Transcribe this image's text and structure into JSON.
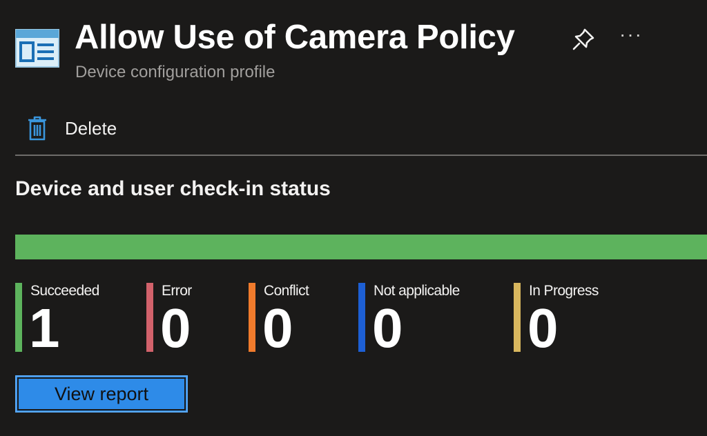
{
  "header": {
    "title": "Allow Use of Camera Policy",
    "subtitle": "Device configuration profile",
    "pin_icon": "pin-icon",
    "more_label": "···"
  },
  "command_bar": {
    "delete_label": "Delete",
    "delete_icon": "trash-icon"
  },
  "status_section": {
    "title": "Device and user check-in status",
    "progress": {
      "succeeded_fraction": 1.0,
      "fill_color": "#5db35d"
    },
    "items": [
      {
        "label": "Succeeded",
        "count": "1",
        "color": "#5db35d"
      },
      {
        "label": "Error",
        "count": "0",
        "color": "#d2626b"
      },
      {
        "label": "Conflict",
        "count": "0",
        "color": "#f07b2c"
      },
      {
        "label": "Not applicable",
        "count": "0",
        "color": "#1d5fd4"
      },
      {
        "label": "In Progress",
        "count": "0",
        "color": "#d8b75e"
      }
    ]
  },
  "actions": {
    "view_report_label": "View report"
  },
  "theme": {
    "background": "#1b1a19",
    "accent": "#2e8be8"
  }
}
